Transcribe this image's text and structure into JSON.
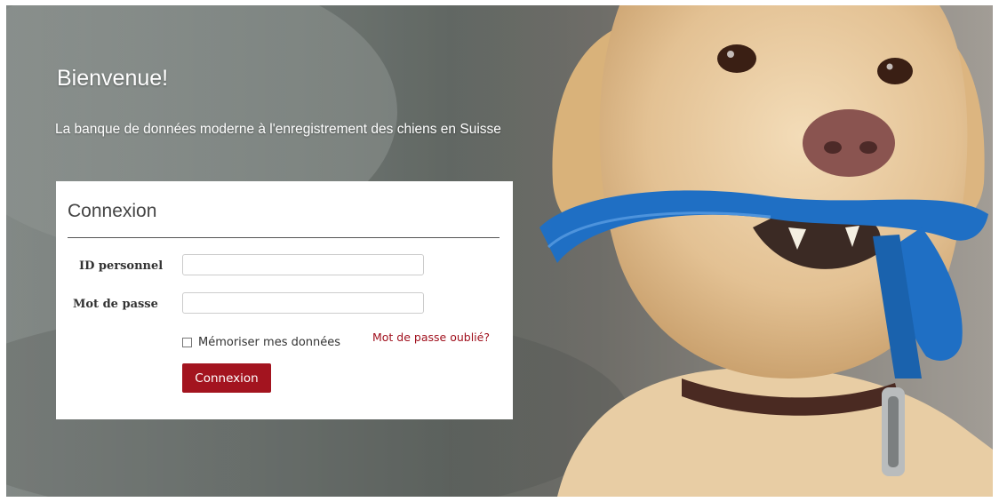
{
  "hero": {
    "title": "Bienvenue!",
    "subtitle": "La banque de données moderne à l'enregistrement des chiens en Suisse"
  },
  "login": {
    "title": "Connexion",
    "id_label": "ID personnel",
    "id_value": "",
    "password_label": "Mot de passe",
    "password_value": "",
    "remember_label": "Mémoriser mes données",
    "remember_checked": false,
    "forgot_label": "Mot de passe oublié?",
    "submit_label": "Connexion"
  },
  "colors": {
    "accent": "#a3141f",
    "link": "#a0101d",
    "leash": "#1f6fc4"
  }
}
